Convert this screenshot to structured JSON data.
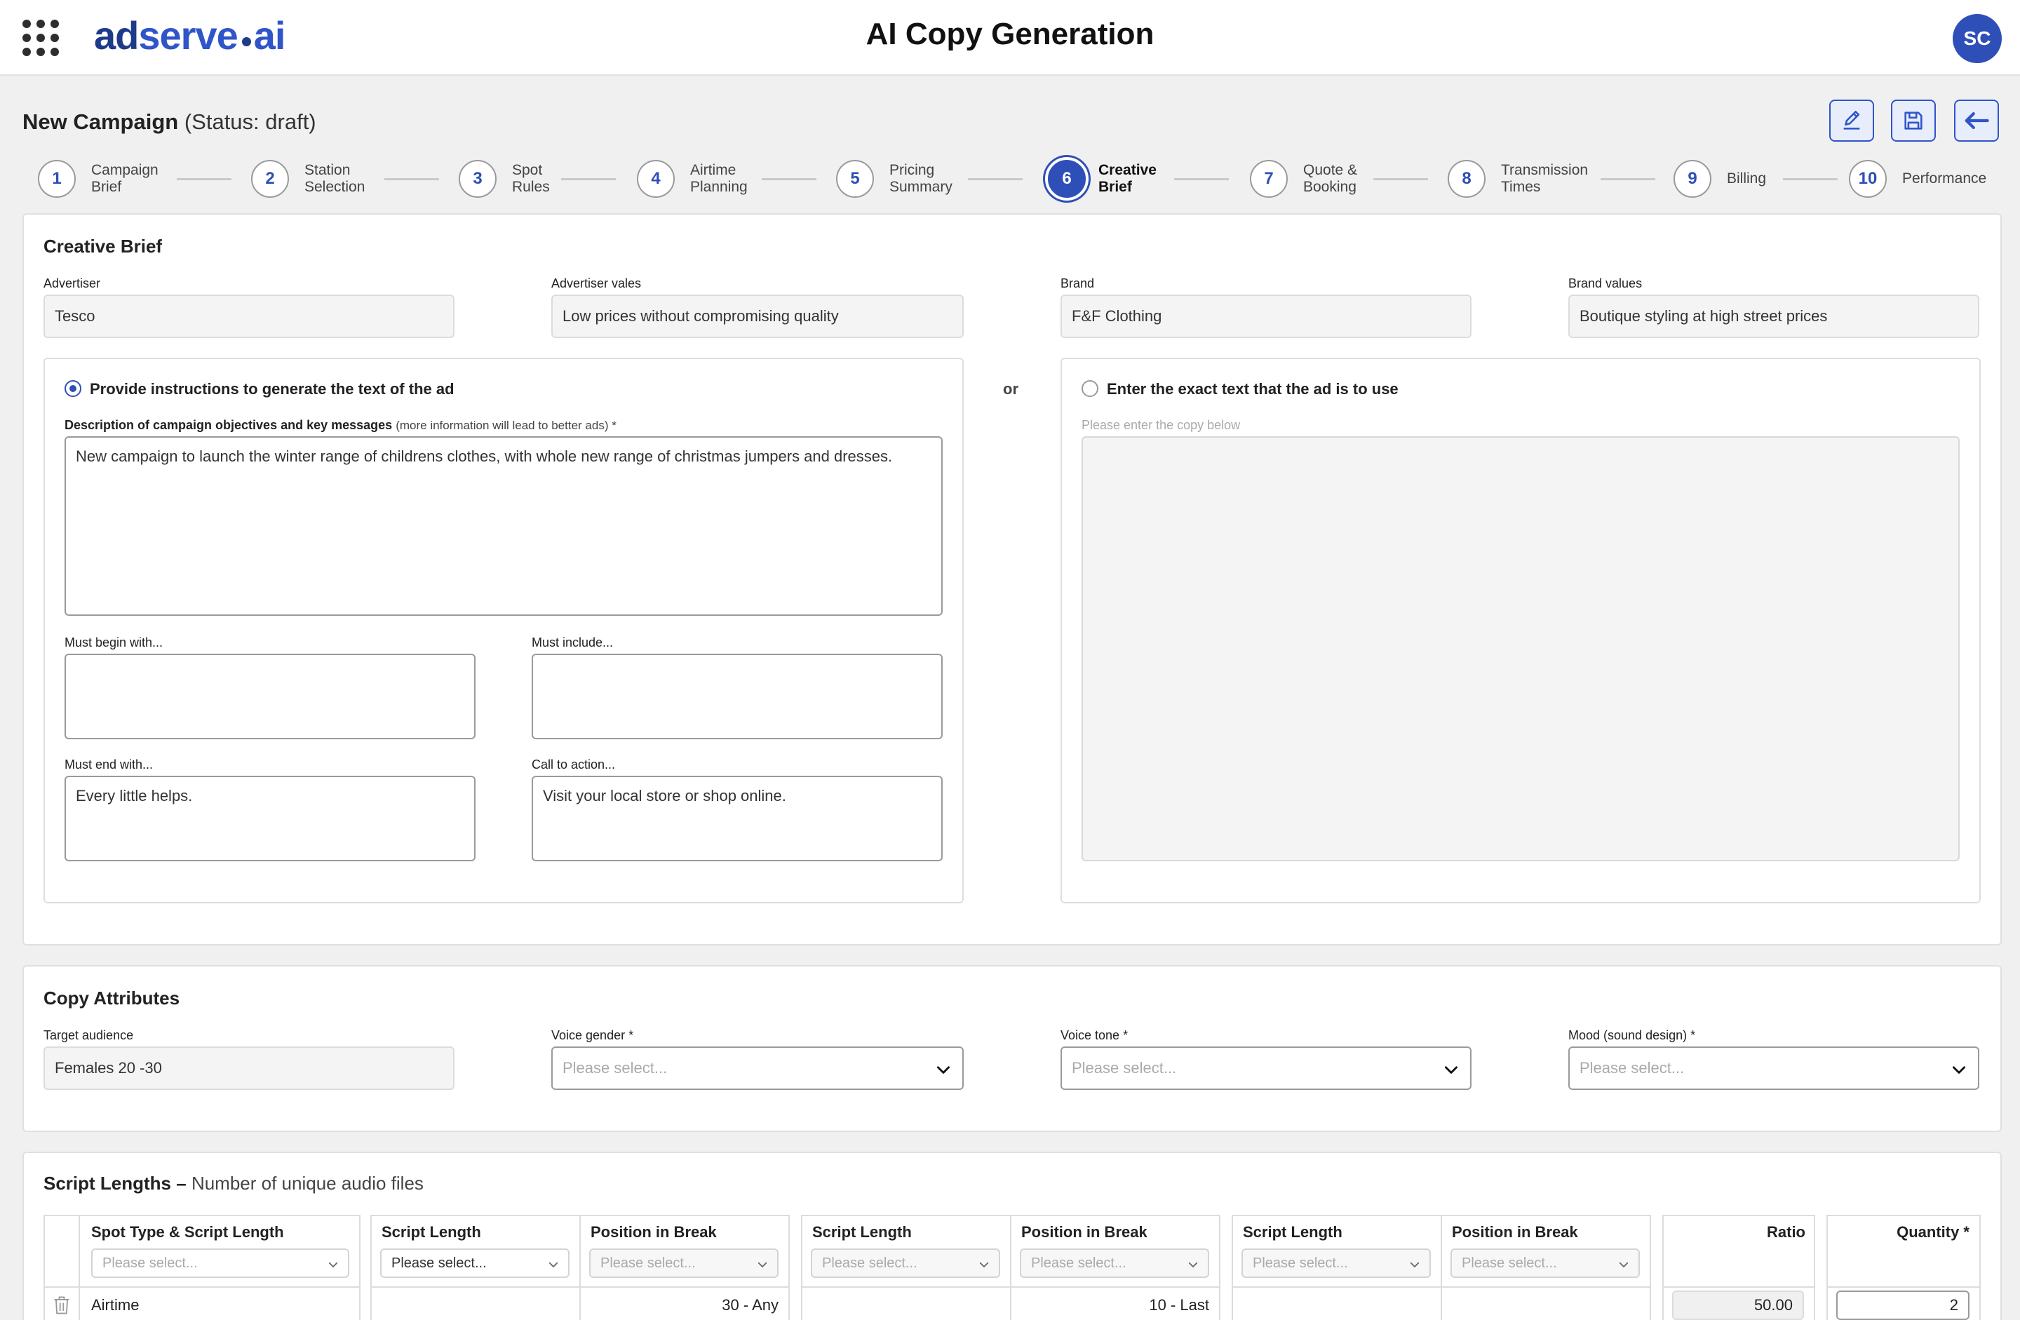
{
  "app": {
    "logo_ad": "ad",
    "logo_serve": "serve",
    "logo_ai": "ai",
    "title": "AI Copy Generation",
    "user_initials": "SC"
  },
  "campaign": {
    "name": "New Campaign",
    "status": "(Status: draft)"
  },
  "toolbar": {
    "icons": [
      "pencil-icon",
      "save-icon",
      "arrow-left-icon"
    ]
  },
  "steps": [
    {
      "num": "1",
      "label": "Campaign\nBrief"
    },
    {
      "num": "2",
      "label": "Station\nSelection"
    },
    {
      "num": "3",
      "label": "Spot\nRules"
    },
    {
      "num": "4",
      "label": "Airtime\nPlanning"
    },
    {
      "num": "5",
      "label": "Pricing\nSummary"
    },
    {
      "num": "6",
      "label": "Creative\nBrief"
    },
    {
      "num": "7",
      "label": "Quote &\nBooking"
    },
    {
      "num": "8",
      "label": "Transmission\nTimes"
    },
    {
      "num": "9",
      "label": "Billing"
    },
    {
      "num": "10",
      "label": "Performance"
    }
  ],
  "active_step": 6,
  "creative": {
    "title": "Creative Brief",
    "advertiser_label": "Advertiser",
    "advertiser": "Tesco",
    "advertiser_values_label": "Advertiser vales",
    "advertiser_values": "Low prices without compromising quality",
    "brand_label": "Brand",
    "brand": "F&F Clothing",
    "brand_values_label": "Brand values",
    "brand_values": "Boutique styling at high street prices",
    "option_instructions": "Provide instructions to generate the text of the ad",
    "or": "or",
    "option_exact": "Enter the exact text that the ad is to use",
    "description_label": "Description of campaign objectives and key messages",
    "description_hint": "(more information will lead to better ads) *",
    "description": "New campaign to launch the winter range of childrens clothes, with  whole new range of christmas jumpers and dresses.",
    "must_begin_label": "Must begin with...",
    "must_begin": "",
    "must_include_label": "Must include...",
    "must_include": "",
    "must_end_label": "Must end with...",
    "must_end": "Every little helps.",
    "cta_label": "Call to action...",
    "cta": "Visit your local store or shop online.",
    "copy_placeholder": "Please enter the copy below"
  },
  "attributes": {
    "title": "Copy Attributes",
    "target_label": "Target audience",
    "target": "Females 20 -30",
    "voice_gender_label": "Voice gender *",
    "voice_tone_label": "Voice tone *",
    "mood_label": "Mood (sound design) *",
    "placeholder": "Please select..."
  },
  "scripts": {
    "title": "Script Lengths –",
    "subtitle": "Number of unique audio files",
    "headers": {
      "spot_type": "Spot Type & Script Length",
      "script_length": "Script Length",
      "position": "Position in Break",
      "ratio": "Ratio",
      "quantity": "Quantity *"
    },
    "placeholder": "Please select...",
    "row": {
      "type": "Airtime",
      "length1": "30 - Any",
      "position1": "10 - Last",
      "ratio": "50.00",
      "quantity": "2"
    }
  }
}
